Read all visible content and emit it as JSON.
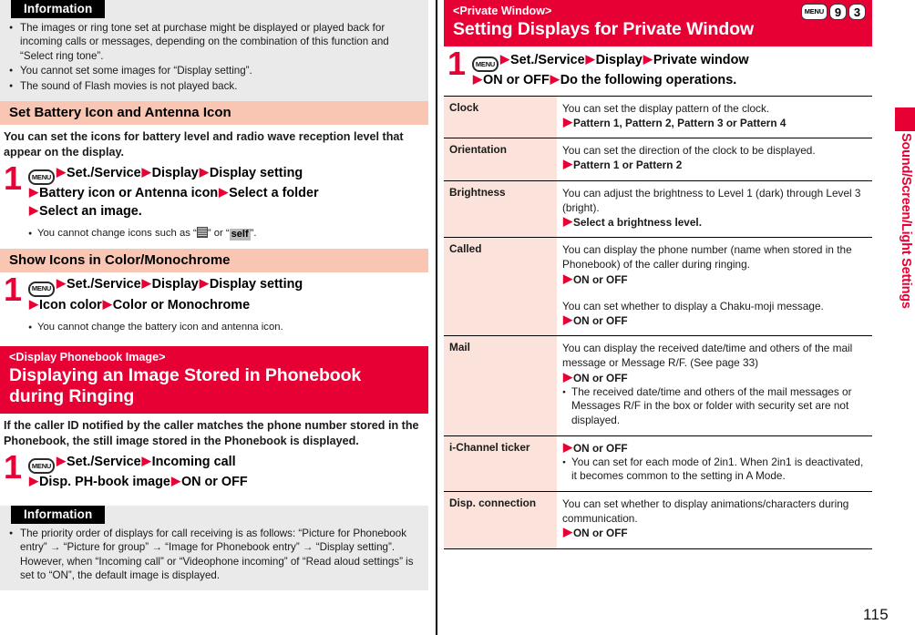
{
  "page": {
    "number": "115",
    "side_tab_label": "Sound/Screen/Light Settings",
    "accent_red": "#e60033",
    "section_pink": "#f9c6b4",
    "table_key_pink": "#fbe3dc",
    "info_gray": "#eaeaea"
  },
  "left": {
    "info_top": {
      "title": "Information",
      "items": [
        "The images or ring tone set at purchase might be displayed or played back for incoming calls or messages, depending on the combination of this function and “Select ring tone”.",
        "You cannot set some images for “Display setting”.",
        "The sound of Flash movies is not played back."
      ]
    },
    "section_battery": {
      "heading": "Set Battery Icon and Antenna Icon",
      "intro": "You can set the icons for battery level and radio wave reception level that appear on the display.",
      "step_number": "1",
      "menu_key": "MENU",
      "line1_a": "Set./Service",
      "line1_b": "Display",
      "line1_c": "Display setting",
      "line2_a": "Battery icon or Antenna icon",
      "line2_b": "Select a folder",
      "line3_a": "Select an image.",
      "note_pre": "You cannot change icons such as “",
      "note_mid": "” or “",
      "note_self": "self",
      "note_end": "”."
    },
    "section_icon_color": {
      "heading": "Show Icons in Color/Monochrome",
      "step_number": "1",
      "menu_key": "MENU",
      "line1_a": "Set./Service",
      "line1_b": "Display",
      "line1_c": "Display setting",
      "line2_a": "Icon color",
      "line2_b": "Color or Monochrome",
      "note": "You cannot change the battery icon and antenna icon."
    },
    "section_phonebook": {
      "banner_sub": "<Display Phonebook Image>",
      "banner_main": "Displaying an Image Stored in Phonebook during Ringing",
      "intro": "If the caller ID notified by the caller matches the phone number stored in the Phonebook, the still image stored in the Phonebook is displayed.",
      "step_number": "1",
      "menu_key": "MENU",
      "line1_a": "Set./Service",
      "line1_b": "Incoming call",
      "line2_a": "Disp. PH-book image",
      "line2_b": "ON or OFF"
    },
    "info_bottom": {
      "title": "Information",
      "items": [
        "The priority order of displays for call receiving is as follows: “Picture for Phonebook entry” → “Picture for group” → “Image for Phonebook entry” → “Display setting”. However, when “Incoming call” or “Videophone incoming” of “Read aloud settings” is set to “ON”, the default image is displayed."
      ]
    }
  },
  "right": {
    "banner_sub": "<Private Window>",
    "banner_main": "Setting Displays for Private Window",
    "keychips": [
      "MENU",
      "9",
      "3"
    ],
    "step_number": "1",
    "menu_key": "MENU",
    "line1_a": "Set./Service",
    "line1_b": "Display",
    "line1_c": "Private window",
    "line2_a": "ON or OFF",
    "line2_b": "Do the following operations.",
    "table": [
      {
        "key": "Clock",
        "desc": "You can set the display pattern of the clock.",
        "option": "Pattern 1, Pattern 2, Pattern 3 or Pattern 4"
      },
      {
        "key": "Orientation",
        "desc": "You can set the direction of the clock to be displayed.",
        "option": "Pattern 1 or Pattern 2"
      },
      {
        "key": "Brightness",
        "desc": "You can adjust the brightness to Level 1 (dark) through Level 3 (bright).",
        "option": "Select a brightness level."
      },
      {
        "key": "Called",
        "desc": "You can display the phone number (name when stored in the Phonebook) of the caller during ringing.",
        "option": "ON or OFF",
        "desc2": "You can set whether to display a Chaku-moji message.",
        "option2": "ON or OFF"
      },
      {
        "key": "Mail",
        "desc": "You can display the received date/time and others of the mail message or Message R/F. (See page 33)",
        "option": "ON or OFF",
        "bullets": [
          "The received date/time and others of the mail messages or Messages R/F in the box or folder with security set are not displayed."
        ]
      },
      {
        "key": "i-Channel ticker",
        "option": "ON or OFF",
        "bullets": [
          "You can set for each mode of 2in1. When 2in1 is deactivated, it becomes common to the setting in A Mode."
        ]
      },
      {
        "key": "Disp. connection",
        "desc": "You can set whether to display animations/characters during communication.",
        "option": "ON or OFF"
      }
    ]
  }
}
